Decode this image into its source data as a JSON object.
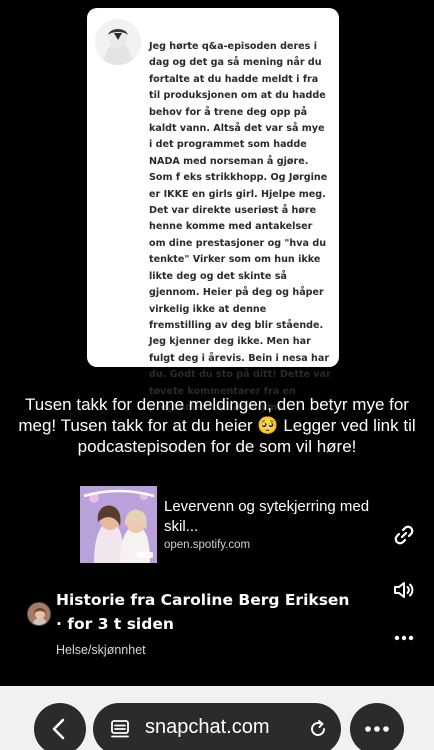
{
  "message_card": {
    "text": "Jeg hørte q&a-episoden deres i dag og det ga så mening når du fortalte at du hadde meldt i fra til produksjonen om at du hadde behov for å trene deg opp på kaldt vann. Altså det var så mye i det programmet som hadde NADA med norseman å gjøre. Som f eks strikkhopp. Og Jørgine er IKKE en girls girl. Hjelpe meg. Det var direkte useriøst å høre henne komme med antakelser om dine prestasjoner og \"hva du tenkte\" Virker som om hun ikke likte deg og det skinte så gjennom. Heier på deg og håper virkelig ikke at denne fremstilling av deg blir stående. Jeg kjenner deg ikke. Men har fulgt deg i årevis. Bein i nesa har du. Godt du sto på ditt! Dette var tøvete kommentarer fra en programleder. (Anonym)"
  },
  "caption": "Tusen takk for denne meldingen, den betyr mye for meg! Tusen takk for at du heier 🥺 Legger ved link til podcastepisoden for de som vil høre!",
  "link": {
    "title": "Levervenn og sytekjerring med skil...",
    "domain": "open.spotify.com"
  },
  "story": {
    "title": "Historie fra Caroline Berg Eriksen · for 3 t siden",
    "category": "Helse/skjønnhet"
  },
  "browser": {
    "url": "snapchat.com"
  },
  "icons": {
    "link": "link-icon",
    "sound": "sound-icon",
    "more": "more-icon",
    "back": "chevron-left-icon",
    "page": "page-icon",
    "reload": "reload-icon"
  }
}
